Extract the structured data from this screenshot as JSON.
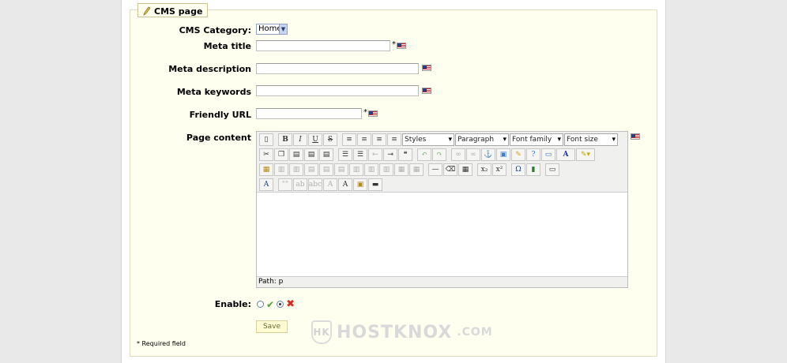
{
  "fieldset": {
    "legend": "CMS page"
  },
  "form": {
    "category_label": "CMS Category:",
    "category_value": "Home",
    "meta_title_label": "Meta title",
    "meta_description_label": "Meta description",
    "meta_keywords_label": "Meta keywords",
    "friendly_url_label": "Friendly URL",
    "page_content_label": "Page content",
    "required_mark": "*",
    "enable_label": "Enable:",
    "save_label": "Save",
    "required_note": "* Required field"
  },
  "editor": {
    "styles": "Styles",
    "format": "Paragraph",
    "font_family": "Font family",
    "font_size": "Font size",
    "path": "Path: p"
  },
  "icons": {
    "flag": "us-flag-icon",
    "check": "✔",
    "cross": "✖",
    "bold": "B",
    "italic": "I",
    "underline": "U",
    "strike": "S",
    "quote": "❝",
    "omega": "Ω",
    "sub": "x₂",
    "sup": "x²",
    "font_color": "A"
  },
  "watermark": {
    "text": "HOSTKNOX",
    "suffix": ".COM"
  }
}
